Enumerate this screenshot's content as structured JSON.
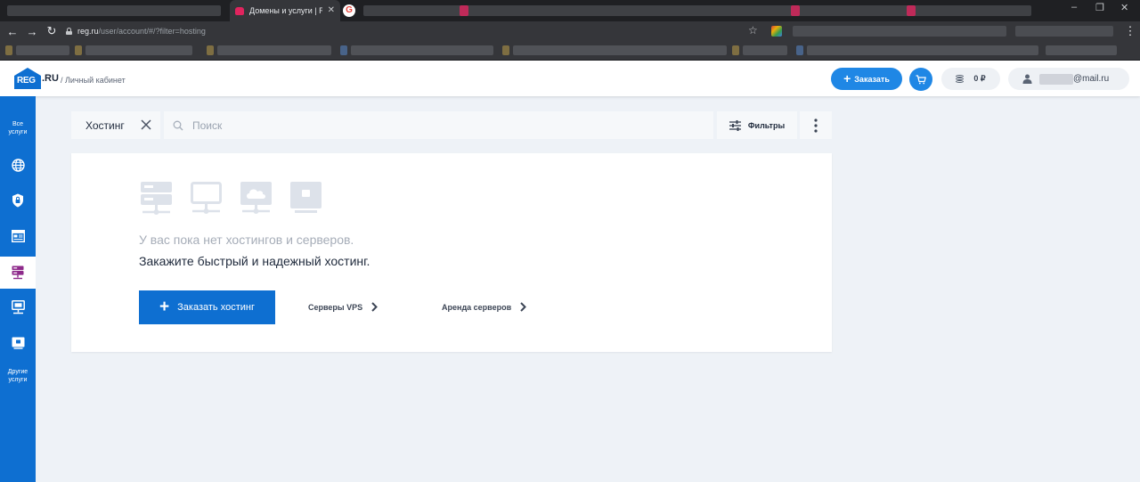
{
  "browser": {
    "active_tab_title": "Домены и услуги | REG",
    "url_host": "reg.ru",
    "url_path": "/user/account/#/?filter=hosting"
  },
  "header": {
    "logo_main": "REG",
    "logo_suffix": ".RU",
    "breadcrumb": "/ Личный кабинет",
    "order_label": "Заказать",
    "balance": "0 ₽",
    "user_email_suffix": "@mail.ru"
  },
  "sidebar": {
    "items": [
      {
        "label": "Все\nуслуги",
        "icon": "all-services"
      },
      {
        "label": "",
        "icon": "globe-icon"
      },
      {
        "label": "",
        "icon": "shield-icon"
      },
      {
        "label": "",
        "icon": "website-builder-icon"
      },
      {
        "label": "",
        "icon": "hosting-icon",
        "active": true
      },
      {
        "label": "",
        "icon": "vps-icon"
      },
      {
        "label": "",
        "icon": "dedicated-server-icon"
      },
      {
        "label": "Другие\nуслуги",
        "icon": "other-services"
      }
    ]
  },
  "filters": {
    "active_filter": "Хостинг",
    "search_placeholder": "Поиск",
    "filters_label": "Фильтры"
  },
  "empty_state": {
    "title": "У вас пока нет хостингов и серверов.",
    "subtitle": "Закажите быстрый и надежный хостинг.",
    "primary_button": "Заказать хостинг",
    "link_vps": "Серверы VPS",
    "link_dedicated": "Аренда серверов"
  },
  "colors": {
    "brand_blue": "#0e6fd1",
    "accent_blue": "#1f87e5",
    "active_icon_purple": "#8e2a8b",
    "background": "#eef2f7"
  }
}
